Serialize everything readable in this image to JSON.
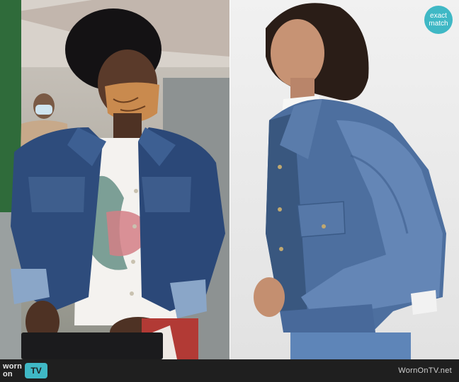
{
  "badge": {
    "line1": "exact",
    "line2": "match",
    "color": "#3fb8c5"
  },
  "footer": {
    "logo_word1": "worn",
    "logo_word2": "on",
    "logo_word3": "TV",
    "logo_accent": "#3fb8c5",
    "site_url": "WornOnTV.net"
  },
  "photos": {
    "left_icon": "person-photo",
    "right_icon": "product-photo"
  },
  "colors": {
    "denim_dark": "#2d4a78",
    "denim_light": "#5f82b3",
    "footer_bg": "#1f1f1f"
  }
}
